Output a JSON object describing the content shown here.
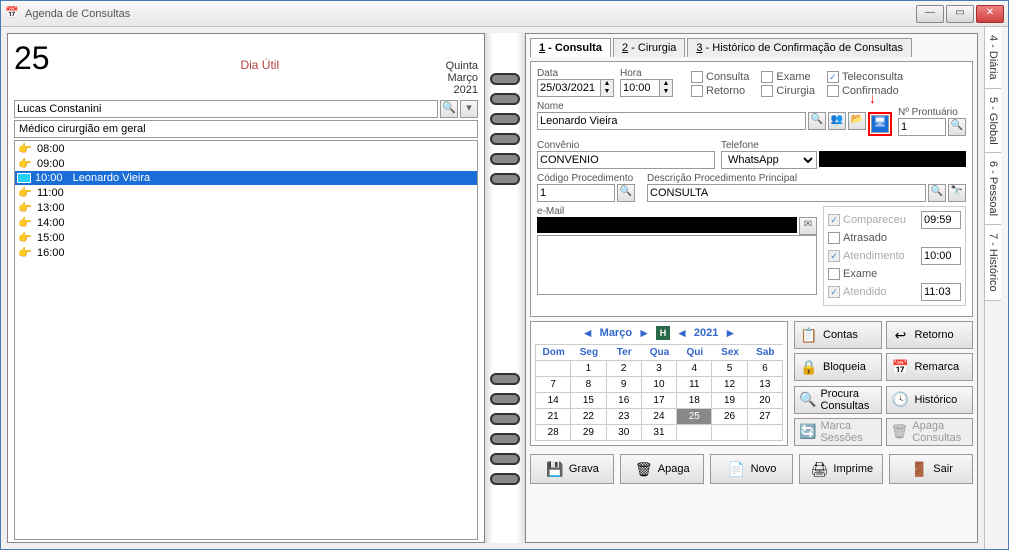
{
  "window": {
    "title": "Agenda de Consultas"
  },
  "sidetabs": [
    "4 - Diária",
    "5 - Global",
    "6 - Pessoal",
    "7 - Histórico"
  ],
  "day": {
    "num": "25",
    "type": "Dia Útil",
    "weekday": "Quinta",
    "month": "Março",
    "year": "2021",
    "doctor": "Lucas Constanini",
    "specialty": "Médico cirurgião em geral"
  },
  "slots": [
    {
      "time": "08:00",
      "name": ""
    },
    {
      "time": "09:00",
      "name": ""
    },
    {
      "time": "10:00",
      "name": "Leonardo Vieira",
      "selected": true
    },
    {
      "time": "11:00",
      "name": ""
    },
    {
      "time": "13:00",
      "name": ""
    },
    {
      "time": "14:00",
      "name": ""
    },
    {
      "time": "15:00",
      "name": ""
    },
    {
      "time": "16:00",
      "name": ""
    }
  ],
  "tabs": [
    {
      "key": "1",
      "label": "Consulta",
      "active": true
    },
    {
      "key": "2",
      "label": "Cirurgia"
    },
    {
      "key": "3",
      "label": "Histórico de Confirmação de Consultas"
    }
  ],
  "form": {
    "labels": {
      "data": "Data",
      "hora": "Hora",
      "nome": "Nome",
      "prontuario": "Nº Prontuário",
      "convenio": "Convênio",
      "telefone": "Telefone",
      "codproc": "Código Procedimento",
      "descproc": "Descrição Procedimento Principal",
      "email": "e-Mail"
    },
    "data": "25/03/2021",
    "hora": "10:00",
    "checks": {
      "consulta": "Consulta",
      "exame": "Exame",
      "teleconsulta": "Teleconsulta",
      "retorno": "Retorno",
      "cirurgia": "Cirurgia",
      "confirmado": "Confirmado"
    },
    "nome": "Leonardo Vieira",
    "prontuario": "1",
    "convenio": "CONVENIO",
    "telefone_tipo": "WhatsApp",
    "codproc": "1",
    "descproc": "CONSULTA",
    "status": {
      "compareceu": "Compareceu",
      "compareceu_t": "09:59",
      "atrasado": "Atrasado",
      "atendimento": "Atendimento",
      "atendimento_t": "10:00",
      "exame": "Exame",
      "atendido": "Atendido",
      "atendido_t": "11:03"
    }
  },
  "cal": {
    "month": "Março",
    "year": "2021",
    "dow": [
      "Dom",
      "Seg",
      "Ter",
      "Qua",
      "Qui",
      "Sex",
      "Sab"
    ],
    "rows": [
      [
        "",
        "1",
        "2",
        "3",
        "4",
        "5",
        "6"
      ],
      [
        "7",
        "8",
        "9",
        "10",
        "11",
        "12",
        "13"
      ],
      [
        "14",
        "15",
        "16",
        "17",
        "18",
        "19",
        "20"
      ],
      [
        "21",
        "22",
        "23",
        "24",
        "25",
        "26",
        "27"
      ],
      [
        "28",
        "29",
        "30",
        "31",
        "",
        "",
        ""
      ]
    ],
    "selected": "25"
  },
  "buttons": {
    "contas": "Contas",
    "retorno": "Retorno",
    "bloqueia": "Bloqueia",
    "remarca": "Remarca",
    "procura": "Procura Consultas",
    "historico": "Histórico",
    "marca": "Marca Sessões",
    "apaga_c": "Apaga Consultas",
    "grava": "Grava",
    "apaga": "Apaga",
    "novo": "Novo",
    "imprime": "Imprime",
    "sair": "Sair"
  },
  "chart_data": null
}
